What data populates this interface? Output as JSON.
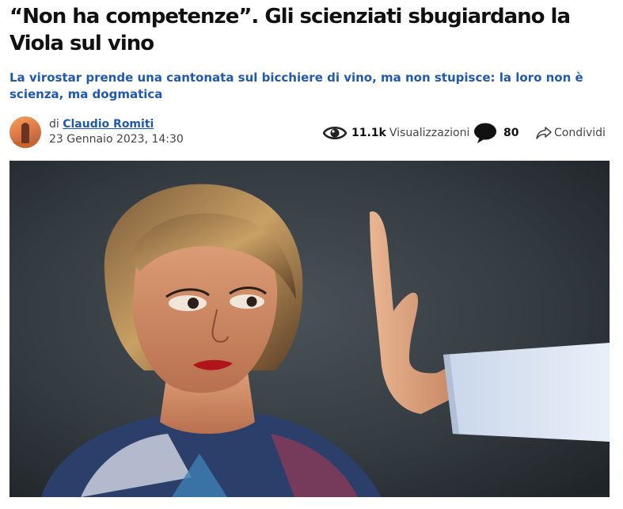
{
  "article": {
    "headline": "“Non ha competenze”. Gli scienziati sbugiardano la Viola sul vino",
    "subtitle": "La virostar prende una cantonata sul bicchiere di vino, ma non stupisce: la loro non è scienza, ma dogmatica",
    "author_prefix": "di",
    "author_name": "Claudio Romiti",
    "date": "23 Gennaio 2023, 14:30"
  },
  "stats": {
    "views_count": "11.1k",
    "views_label": "Visualizzazioni",
    "comments_count": "80",
    "share_label": "Condividi"
  },
  "icons": {
    "views": "eye-icon",
    "comments": "comment-bubble-icon",
    "share": "share-arrow-icon",
    "avatar": "author-avatar"
  },
  "colors": {
    "headline": "#111111",
    "subtitle": "#2059b0",
    "link": "#2059b0",
    "meta_text": "#444444",
    "image_background": "#2b3238"
  }
}
